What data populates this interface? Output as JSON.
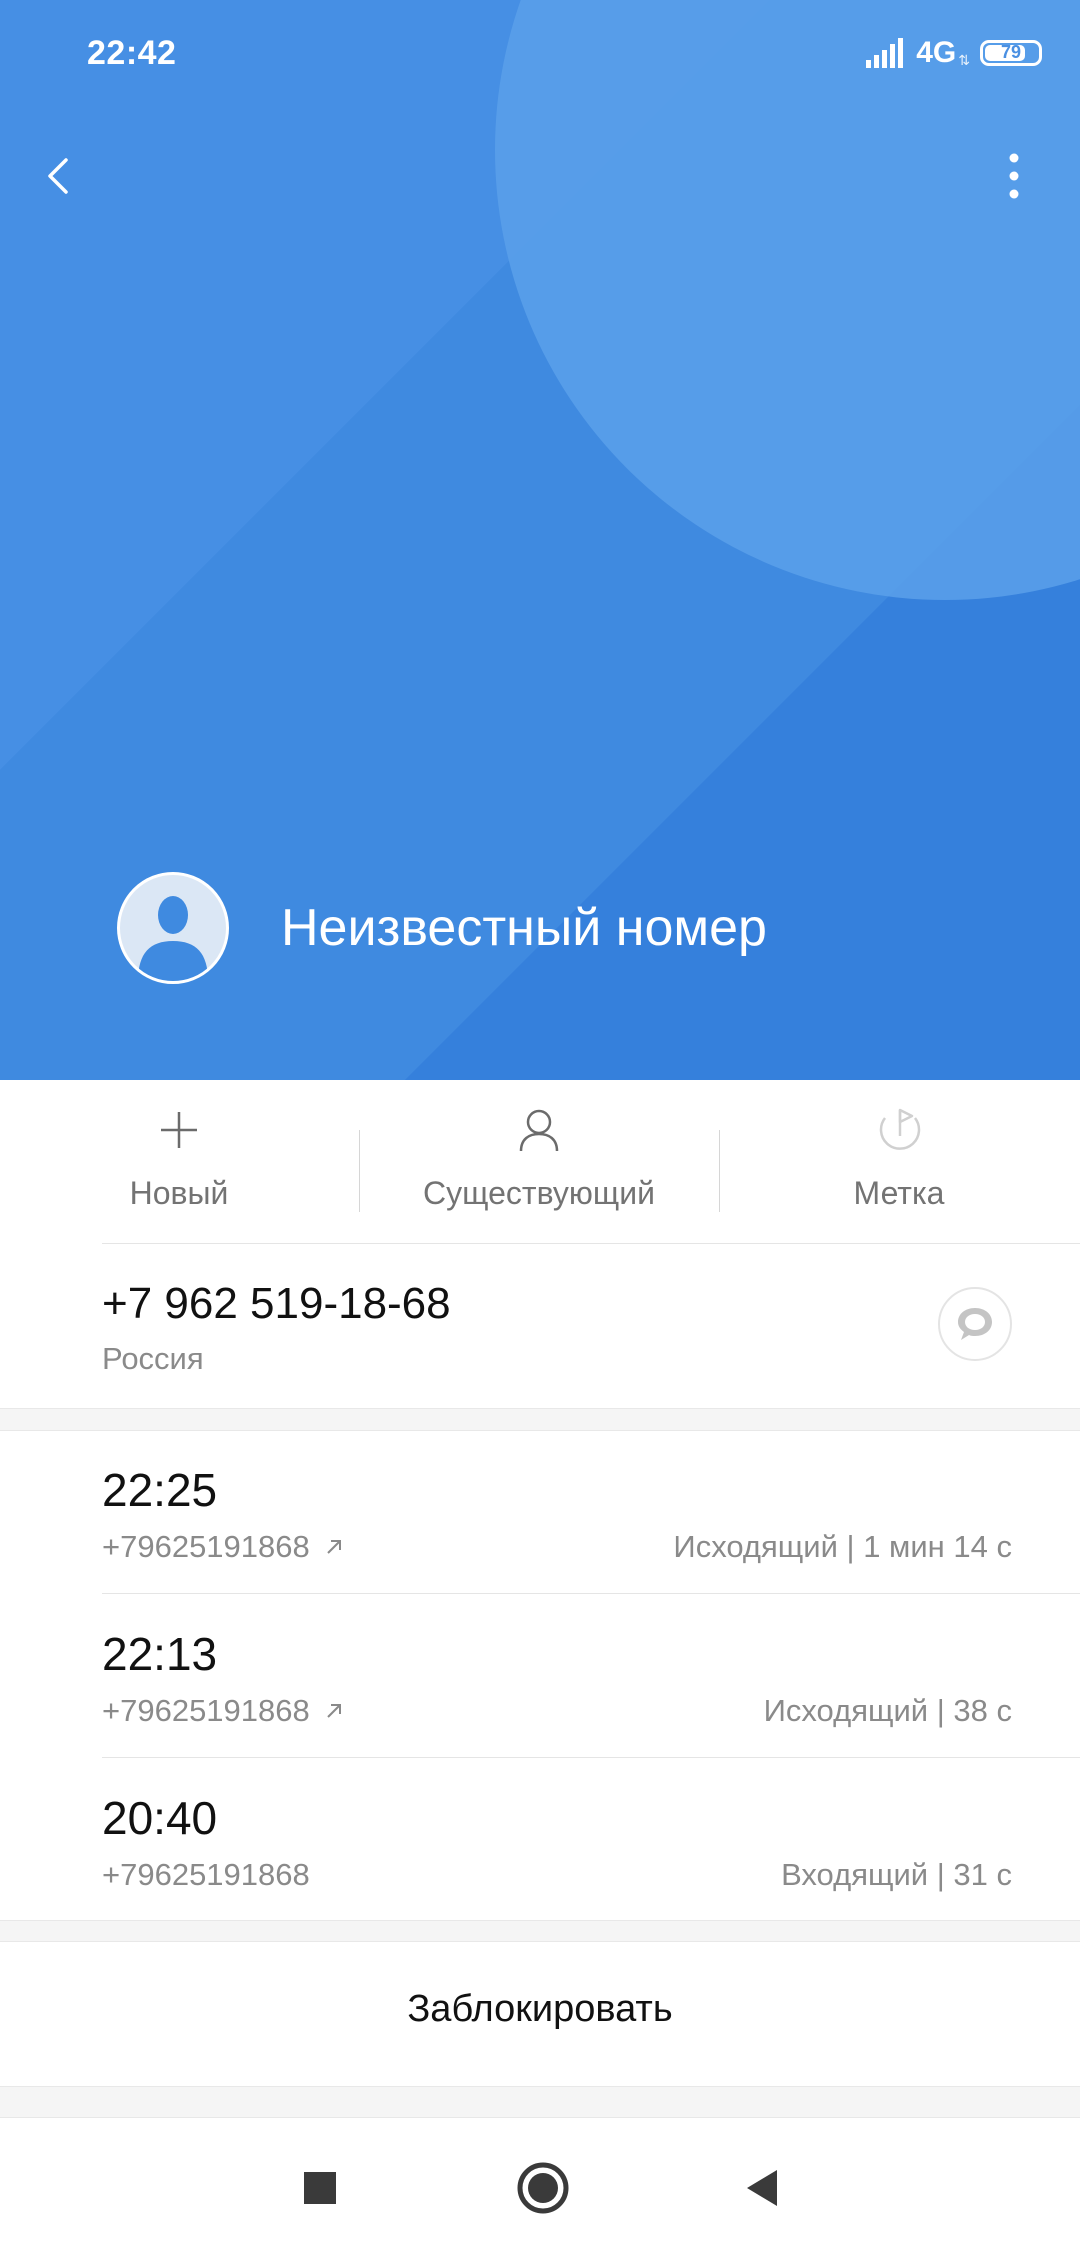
{
  "status_bar": {
    "time": "22:42",
    "network": "4G",
    "battery": "79",
    "battery_level": 0.79
  },
  "header": {
    "back_icon": "chevron-left-icon",
    "menu_icon": "more-vertical-icon",
    "avatar_icon": "person-silhouette-icon",
    "contact_name": "Неизвестный номер",
    "background_color": "#3b87df"
  },
  "actions": [
    {
      "label": "Новый",
      "icon": "plus-icon"
    },
    {
      "label": "Существующий",
      "icon": "person-outline-icon"
    },
    {
      "label": "Метка",
      "icon": "flag-tag-icon"
    }
  ],
  "phone": {
    "number": "+7 962 519-18-68",
    "region": "Россия",
    "message_icon": "message-bubble-icon"
  },
  "calls": [
    {
      "time": "22:25",
      "number": "+79625191868",
      "outgoing": true,
      "detail": "Исходящий | 1 мин 14 с"
    },
    {
      "time": "22:13",
      "number": "+79625191868",
      "outgoing": true,
      "detail": "Исходящий | 38 с"
    },
    {
      "time": "20:40",
      "number": "+79625191868",
      "outgoing": false,
      "detail": "Входящий | 31 с"
    }
  ],
  "block_label": "Заблокировать",
  "nav": {
    "recents_icon": "square-icon",
    "home_icon": "circle-home-icon",
    "back_icon": "triangle-back-icon"
  }
}
